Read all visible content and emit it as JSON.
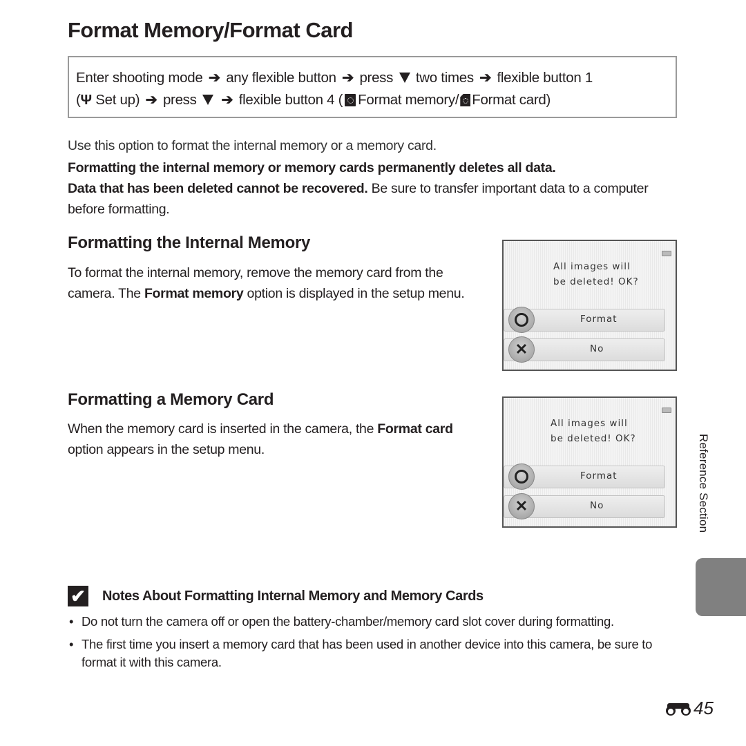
{
  "title": "Format Memory/Format Card",
  "path": {
    "line1": [
      "Enter shooting mode",
      "any flexible button",
      "press",
      "two times",
      "flexible button 1"
    ],
    "setup_label": "Set up",
    "line2_press": "press",
    "line2_button": "flexible button 4 (",
    "format_memory": "Format memory/",
    "format_card": "Format card)",
    "arrow": "➔"
  },
  "intro": "Use this option to format the internal memory or a memory card.",
  "warning": {
    "bold1": "Formatting the internal memory or memory cards permanently deletes all data.",
    "bold2": "Data that has been deleted cannot be recovered.",
    "normal": " Be sure to transfer important data to a computer before formatting."
  },
  "sections": [
    {
      "heading": "Formatting the Internal Memory",
      "text_before": "To format the internal memory, remove the memory card from the camera. The ",
      "text_bold": "Format memory",
      "text_after": " option is displayed in the setup menu.",
      "screen": {
        "message_line1": "All images will",
        "message_line2": "be deleted! OK?",
        "ok_label": "Format",
        "no_label": "No"
      }
    },
    {
      "heading": "Formatting a Memory Card",
      "text_before": "When the memory card is inserted in the camera, the ",
      "text_bold": "Format card",
      "text_after": " option appears in the setup menu.",
      "screen": {
        "message_line1": "All images will",
        "message_line2": "be deleted! OK?",
        "ok_label": "Format",
        "no_label": "No"
      }
    }
  ],
  "side_label": "Reference Section",
  "notes": {
    "title": "Notes About Formatting Internal Memory and Memory Cards",
    "items": [
      "Do not turn the camera off or open the battery-chamber/memory card slot cover during formatting.",
      "The first time you insert a memory card that has been used in another device into this camera, be sure to format it with this camera."
    ]
  },
  "page_number": "45"
}
